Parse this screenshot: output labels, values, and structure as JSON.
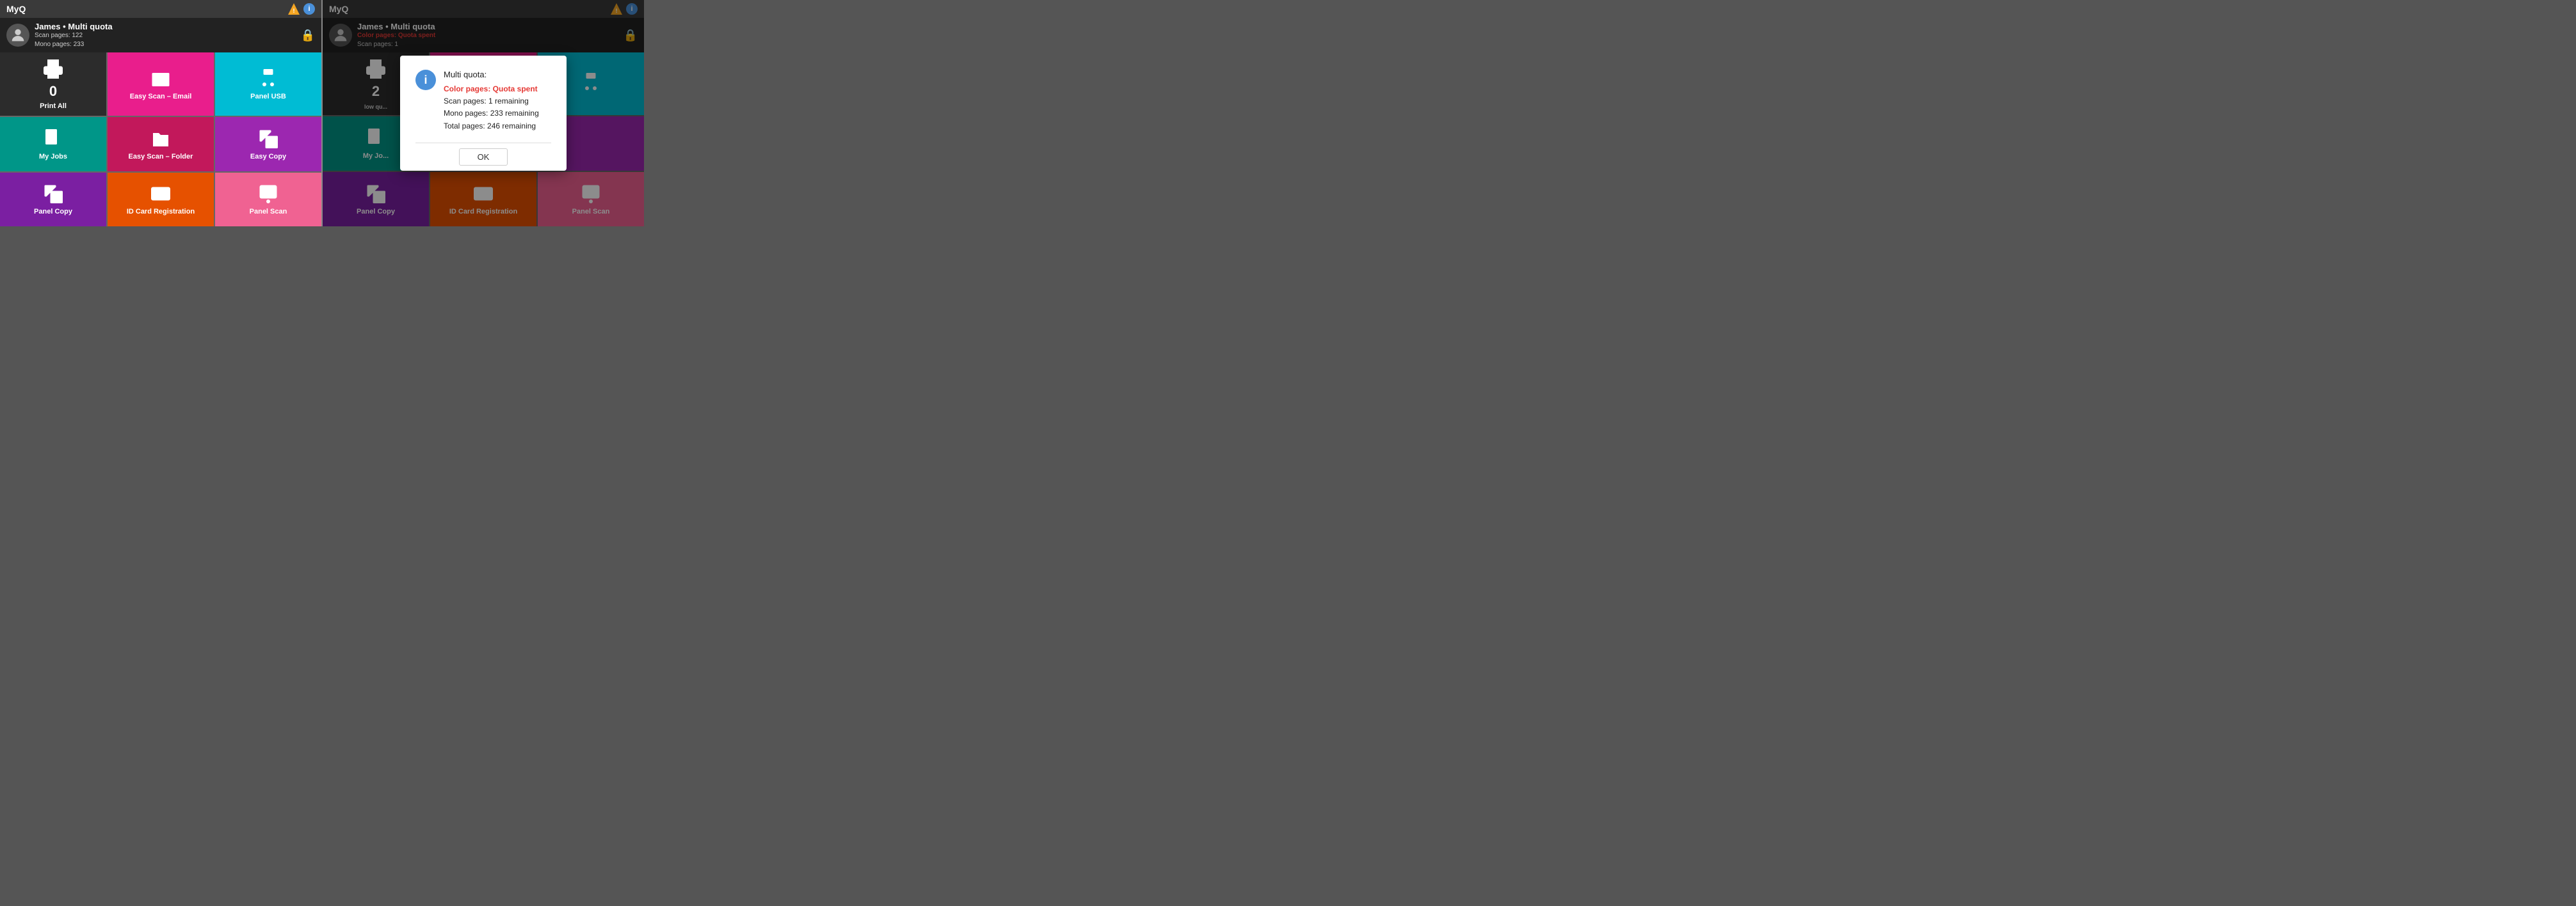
{
  "app": {
    "title": "MyQ"
  },
  "panel_left": {
    "title": "MyQ",
    "user": {
      "name": "James",
      "quota_label": "Multi quota",
      "scan_pages": "Scan pages: 122",
      "mono_pages": "Mono pages: 233"
    },
    "tiles": [
      {
        "id": "print-all",
        "label": "Print All",
        "color": "dark",
        "icon": "printer",
        "count": "0"
      },
      {
        "id": "easy-scan-email",
        "label": "Easy Scan – Email",
        "color": "pink",
        "icon": "scanner"
      },
      {
        "id": "panel-usb",
        "label": "Panel USB",
        "color": "cyan",
        "icon": "usb"
      },
      {
        "id": "my-jobs",
        "label": "My Jobs",
        "color": "teal",
        "icon": "document"
      },
      {
        "id": "easy-scan-folder",
        "label": "Easy Scan – Folder",
        "color": "magenta",
        "icon": "scanner"
      },
      {
        "id": "easy-copy",
        "label": "Easy Copy",
        "color": "purple2",
        "icon": "copy"
      },
      {
        "id": "panel-copy",
        "label": "Panel Copy",
        "color": "purple",
        "icon": "copy2"
      },
      {
        "id": "id-card-reg",
        "label": "ID Card Registration",
        "color": "orange",
        "icon": "idcard"
      },
      {
        "id": "panel-scan",
        "label": "Panel Scan",
        "color": "pink2",
        "icon": "scanner2"
      }
    ]
  },
  "panel_right": {
    "title": "MyQ",
    "user": {
      "name": "James",
      "quota_label": "Multi quota",
      "color_status": "Color pages: Quota spent",
      "scan_pages": "Scan pages: 1"
    },
    "tiles": [
      {
        "id": "print-all-r",
        "label": "low qu...",
        "color": "dark",
        "icon": "printer",
        "count": "2"
      },
      {
        "id": "easy-scan-email-r",
        "label": "",
        "color": "pink",
        "icon": "scanner"
      },
      {
        "id": "panel-usb-r",
        "label": "",
        "color": "cyan",
        "icon": "usb"
      },
      {
        "id": "my-jobs-r",
        "label": "My Jo...",
        "color": "teal",
        "icon": "document"
      },
      {
        "id": "empty1",
        "label": "",
        "color": "magenta",
        "icon": ""
      },
      {
        "id": "empty2",
        "label": "",
        "color": "purple2",
        "icon": ""
      },
      {
        "id": "panel-copy-r",
        "label": "Panel Copy",
        "color": "purple",
        "icon": "copy2"
      },
      {
        "id": "id-card-reg-r",
        "label": "ID Card Registration",
        "color": "orange",
        "icon": "idcard"
      },
      {
        "id": "panel-scan-r",
        "label": "Panel Scan",
        "color": "pink2",
        "icon": "scanner2"
      }
    ],
    "dialog": {
      "title": "Multi quota:",
      "color_status": "Color pages: Quota spent",
      "scan_remaining": "Scan pages: 1 remaining",
      "mono_remaining": "Mono pages: 233 remaining",
      "total_remaining": "Total pages: 246 remaining",
      "ok_label": "OK"
    }
  }
}
